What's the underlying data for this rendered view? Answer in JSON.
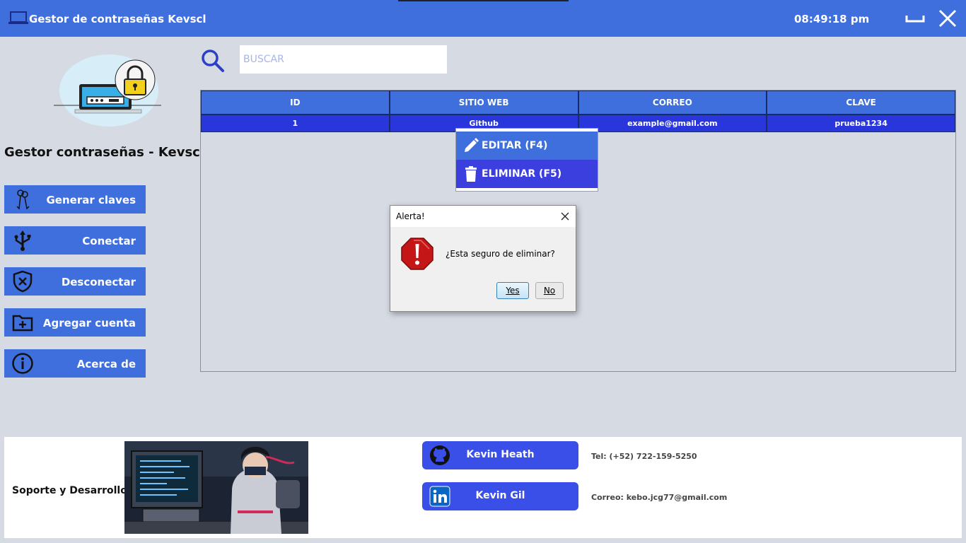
{
  "window": {
    "title": "Gestor de contraseñas Kevscl",
    "clock": "08:49:18 pm"
  },
  "sidebar": {
    "title": "Gestor contraseñas - Kevscl",
    "buttons": [
      {
        "label": "Generar claves",
        "icon": "keys-icon"
      },
      {
        "label": "Conectar",
        "icon": "usb-icon"
      },
      {
        "label": "Desconectar",
        "icon": "shield-x-icon"
      },
      {
        "label": "Agregar cuenta",
        "icon": "folder-plus-icon"
      },
      {
        "label": "Acerca de",
        "icon": "info-icon"
      }
    ]
  },
  "search": {
    "placeholder": "BUSCAR",
    "value": ""
  },
  "table": {
    "columns": [
      "ID",
      "SITIO WEB",
      "CORREO",
      "CLAVE"
    ],
    "rows": [
      {
        "id": "1",
        "site": "Github",
        "email": "example@gmail.com",
        "password": "prueba1234"
      }
    ]
  },
  "context_menu": {
    "items": [
      {
        "label": "EDITAR (F4)",
        "icon": "pencil-icon"
      },
      {
        "label": "ELIMINAR (F5)",
        "icon": "trash-icon"
      }
    ]
  },
  "dialog": {
    "title": "Alerta!",
    "message": "¿Esta seguro de eliminar?",
    "yes_label": "Yes",
    "no_label": "No"
  },
  "footer": {
    "support_label": "Soporte y Desarrollo",
    "links": [
      {
        "label": "Kevin Heath",
        "icon": "github-icon"
      },
      {
        "label": "Kevin Gil",
        "icon": "linkedin-icon"
      }
    ],
    "phone": "Tel: (+52) 722-159-5250",
    "email": "Correo: kebo.jcg77@gmail.com"
  },
  "colors": {
    "accent": "#3f6fdc",
    "selected_row": "#2936dc",
    "background": "#d6dae2"
  }
}
